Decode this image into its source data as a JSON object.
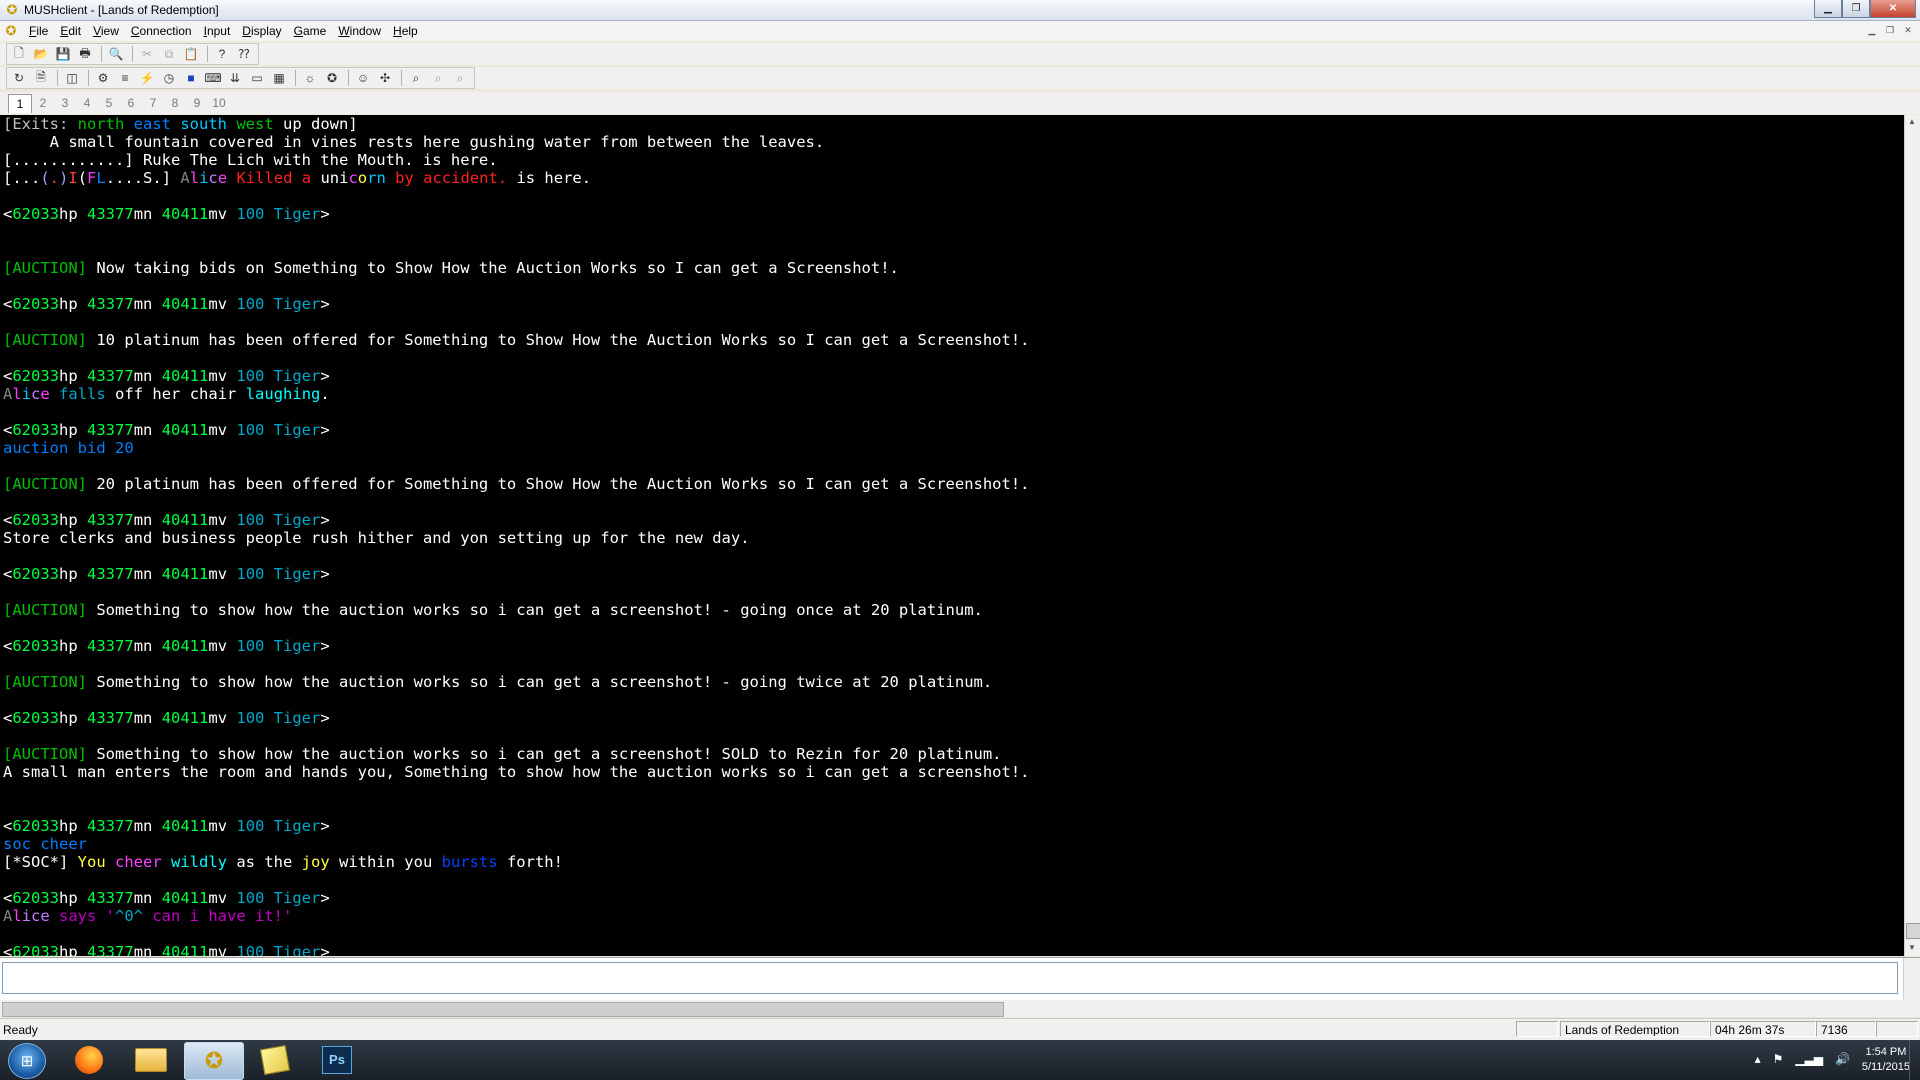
{
  "window": {
    "title": "MUSHclient - [Lands of Redemption]"
  },
  "menu": [
    {
      "pre": "",
      "ul": "F",
      "post": "ile"
    },
    {
      "pre": "",
      "ul": "E",
      "post": "dit"
    },
    {
      "pre": "",
      "ul": "V",
      "post": "iew"
    },
    {
      "pre": "",
      "ul": "C",
      "post": "onnection"
    },
    {
      "pre": "",
      "ul": "I",
      "post": "nput"
    },
    {
      "pre": "",
      "ul": "D",
      "post": "isplay"
    },
    {
      "pre": "",
      "ul": "G",
      "post": "ame"
    },
    {
      "pre": "",
      "ul": "W",
      "post": "indow"
    },
    {
      "pre": "",
      "ul": "H",
      "post": "elp"
    }
  ],
  "world_tabs": [
    "1",
    "2",
    "3",
    "4",
    "5",
    "6",
    "7",
    "8",
    "9",
    "10"
  ],
  "output_lines": [
    [
      {
        "t": "[Exits: ",
        "c": "#c0c0c0"
      },
      {
        "t": "north ",
        "c": "#00c000"
      },
      {
        "t": "east ",
        "c": "#0080ff"
      },
      {
        "t": "south ",
        "c": "#00c8ff"
      },
      {
        "t": "west ",
        "c": "#00c000"
      },
      {
        "t": "up down]",
        "c": "#ffffff"
      }
    ],
    [
      {
        "t": "     A small fountain covered in vines rests here gushing water from between the leaves.",
        "c": "#ffffff"
      }
    ],
    [
      {
        "t": "[............] Ruke The Lich with the Mouth. is here.",
        "c": "#ffffff"
      }
    ],
    [
      {
        "t": "[...",
        "c": "#ffffff"
      },
      {
        "t": "(",
        "c": "#a0a0ff"
      },
      {
        "t": ".",
        "c": "#ff4040"
      },
      {
        "t": ")",
        "c": "#a0a0ff"
      },
      {
        "t": "I",
        "c": "#ff4040"
      },
      {
        "t": "(",
        "c": "#ffffff"
      },
      {
        "t": "F",
        "c": "#ff40ff"
      },
      {
        "t": "L",
        "c": "#0080ff"
      },
      {
        "t": "....S.] ",
        "c": "#ffffff"
      },
      {
        "t": "A",
        "c": "#808080"
      },
      {
        "t": "l",
        "c": "#ff40ff"
      },
      {
        "t": "i",
        "c": "#00c8ff"
      },
      {
        "t": "c",
        "c": "#c080ff"
      },
      {
        "t": "e ",
        "c": "#ff40ff"
      },
      {
        "t": "Killed a ",
        "c": "#ff2020"
      },
      {
        "t": "uni",
        "c": "#ffffff"
      },
      {
        "t": "c",
        "c": "#ff40ff"
      },
      {
        "t": "o",
        "c": "#ffff40"
      },
      {
        "t": "rn ",
        "c": "#00c8ff"
      },
      {
        "t": "by accident.",
        "c": "#ff2020"
      },
      {
        "t": " is here.",
        "c": "#ffffff"
      }
    ],
    [],
    [
      {
        "t": "<",
        "c": "#ffffff"
      },
      {
        "t": "62033",
        "c": "#00ff40"
      },
      {
        "t": "hp ",
        "c": "#ffffff"
      },
      {
        "t": "43377",
        "c": "#00ff40"
      },
      {
        "t": "mn ",
        "c": "#ffffff"
      },
      {
        "t": "40411",
        "c": "#00ff40"
      },
      {
        "t": "mv ",
        "c": "#ffffff"
      },
      {
        "t": "100 Tiger",
        "c": "#00a8c8"
      },
      {
        "t": ">",
        "c": "#ffffff"
      }
    ],
    [],
    [],
    [
      {
        "t": "[AUCTION]",
        "c": "#00c000"
      },
      {
        "t": " Now taking bids on Something to Show How the Auction Works so I can get a Screenshot!.",
        "c": "#ffffff"
      }
    ],
    [],
    [
      {
        "t": "<",
        "c": "#ffffff"
      },
      {
        "t": "62033",
        "c": "#00ff40"
      },
      {
        "t": "hp ",
        "c": "#ffffff"
      },
      {
        "t": "43377",
        "c": "#00ff40"
      },
      {
        "t": "mn ",
        "c": "#ffffff"
      },
      {
        "t": "40411",
        "c": "#00ff40"
      },
      {
        "t": "mv ",
        "c": "#ffffff"
      },
      {
        "t": "100 Tiger",
        "c": "#00a8c8"
      },
      {
        "t": ">",
        "c": "#ffffff"
      }
    ],
    [],
    [
      {
        "t": "[AUCTION]",
        "c": "#00c000"
      },
      {
        "t": " 10 platinum has been offered for Something to Show How the Auction Works so I can get a Screenshot!.",
        "c": "#ffffff"
      }
    ],
    [],
    [
      {
        "t": "<",
        "c": "#ffffff"
      },
      {
        "t": "62033",
        "c": "#00ff40"
      },
      {
        "t": "hp ",
        "c": "#ffffff"
      },
      {
        "t": "43377",
        "c": "#00ff40"
      },
      {
        "t": "mn ",
        "c": "#ffffff"
      },
      {
        "t": "40411",
        "c": "#00ff40"
      },
      {
        "t": "mv ",
        "c": "#ffffff"
      },
      {
        "t": "100 Tiger",
        "c": "#00a8c8"
      },
      {
        "t": ">",
        "c": "#ffffff"
      }
    ],
    [
      {
        "t": "A",
        "c": "#808080"
      },
      {
        "t": "l",
        "c": "#ff40ff"
      },
      {
        "t": "i",
        "c": "#00c8ff"
      },
      {
        "t": "c",
        "c": "#c080ff"
      },
      {
        "t": "e ",
        "c": "#ff40ff"
      },
      {
        "t": "falls ",
        "c": "#00a8c8"
      },
      {
        "t": "off her chair ",
        "c": "#ffffff"
      },
      {
        "t": "laughing",
        "c": "#00ffff"
      },
      {
        "t": ".",
        "c": "#ffffff"
      }
    ],
    [],
    [
      {
        "t": "<",
        "c": "#ffffff"
      },
      {
        "t": "62033",
        "c": "#00ff40"
      },
      {
        "t": "hp ",
        "c": "#ffffff"
      },
      {
        "t": "43377",
        "c": "#00ff40"
      },
      {
        "t": "mn ",
        "c": "#ffffff"
      },
      {
        "t": "40411",
        "c": "#00ff40"
      },
      {
        "t": "mv ",
        "c": "#ffffff"
      },
      {
        "t": "100 Tiger",
        "c": "#00a8c8"
      },
      {
        "t": ">",
        "c": "#ffffff"
      }
    ],
    [
      {
        "t": "auction bid 20",
        "c": "#0080ff"
      }
    ],
    [],
    [
      {
        "t": "[AUCTION]",
        "c": "#00c000"
      },
      {
        "t": " 20 platinum has been offered for Something to Show How the Auction Works so I can get a Screenshot!.",
        "c": "#ffffff"
      }
    ],
    [],
    [
      {
        "t": "<",
        "c": "#ffffff"
      },
      {
        "t": "62033",
        "c": "#00ff40"
      },
      {
        "t": "hp ",
        "c": "#ffffff"
      },
      {
        "t": "43377",
        "c": "#00ff40"
      },
      {
        "t": "mn ",
        "c": "#ffffff"
      },
      {
        "t": "40411",
        "c": "#00ff40"
      },
      {
        "t": "mv ",
        "c": "#ffffff"
      },
      {
        "t": "100 Tiger",
        "c": "#00a8c8"
      },
      {
        "t": ">",
        "c": "#ffffff"
      }
    ],
    [
      {
        "t": "Store clerks and business people rush hither and yon setting up for the new day.",
        "c": "#ffffff"
      }
    ],
    [],
    [
      {
        "t": "<",
        "c": "#ffffff"
      },
      {
        "t": "62033",
        "c": "#00ff40"
      },
      {
        "t": "hp ",
        "c": "#ffffff"
      },
      {
        "t": "43377",
        "c": "#00ff40"
      },
      {
        "t": "mn ",
        "c": "#ffffff"
      },
      {
        "t": "40411",
        "c": "#00ff40"
      },
      {
        "t": "mv ",
        "c": "#ffffff"
      },
      {
        "t": "100 Tiger",
        "c": "#00a8c8"
      },
      {
        "t": ">",
        "c": "#ffffff"
      }
    ],
    [],
    [
      {
        "t": "[AUCTION]",
        "c": "#00c000"
      },
      {
        "t": " Something to show how the auction works so i can get a screenshot! - going once at 20 platinum.",
        "c": "#ffffff"
      }
    ],
    [],
    [
      {
        "t": "<",
        "c": "#ffffff"
      },
      {
        "t": "62033",
        "c": "#00ff40"
      },
      {
        "t": "hp ",
        "c": "#ffffff"
      },
      {
        "t": "43377",
        "c": "#00ff40"
      },
      {
        "t": "mn ",
        "c": "#ffffff"
      },
      {
        "t": "40411",
        "c": "#00ff40"
      },
      {
        "t": "mv ",
        "c": "#ffffff"
      },
      {
        "t": "100 Tiger",
        "c": "#00a8c8"
      },
      {
        "t": ">",
        "c": "#ffffff"
      }
    ],
    [],
    [
      {
        "t": "[AUCTION]",
        "c": "#00c000"
      },
      {
        "t": " Something to show how the auction works so i can get a screenshot! - going twice at 20 platinum.",
        "c": "#ffffff"
      }
    ],
    [],
    [
      {
        "t": "<",
        "c": "#ffffff"
      },
      {
        "t": "62033",
        "c": "#00ff40"
      },
      {
        "t": "hp ",
        "c": "#ffffff"
      },
      {
        "t": "43377",
        "c": "#00ff40"
      },
      {
        "t": "mn ",
        "c": "#ffffff"
      },
      {
        "t": "40411",
        "c": "#00ff40"
      },
      {
        "t": "mv ",
        "c": "#ffffff"
      },
      {
        "t": "100 Tiger",
        "c": "#00a8c8"
      },
      {
        "t": ">",
        "c": "#ffffff"
      }
    ],
    [],
    [
      {
        "t": "[AUCTION]",
        "c": "#00c000"
      },
      {
        "t": " Something to show how the auction works so i can get a screenshot! SOLD to Rezin for 20 platinum.",
        "c": "#ffffff"
      }
    ],
    [
      {
        "t": "A small man enters the room and hands you, Something to show how the auction works so i can get a screenshot!.",
        "c": "#ffffff"
      }
    ],
    [],
    [],
    [
      {
        "t": "<",
        "c": "#ffffff"
      },
      {
        "t": "62033",
        "c": "#00ff40"
      },
      {
        "t": "hp ",
        "c": "#ffffff"
      },
      {
        "t": "43377",
        "c": "#00ff40"
      },
      {
        "t": "mn ",
        "c": "#ffffff"
      },
      {
        "t": "40411",
        "c": "#00ff40"
      },
      {
        "t": "mv ",
        "c": "#ffffff"
      },
      {
        "t": "100 Tiger",
        "c": "#00a8c8"
      },
      {
        "t": ">",
        "c": "#ffffff"
      }
    ],
    [
      {
        "t": "soc cheer",
        "c": "#0080ff"
      }
    ],
    [
      {
        "t": "[*SOC*]",
        "c": "#ffffff"
      },
      {
        "t": " You ",
        "c": "#ffff40"
      },
      {
        "t": "cheer ",
        "c": "#ff40ff"
      },
      {
        "t": "wildly ",
        "c": "#00ffff"
      },
      {
        "t": "as the ",
        "c": "#ffffff"
      },
      {
        "t": "joy ",
        "c": "#ffff40"
      },
      {
        "t": "within you ",
        "c": "#ffffff"
      },
      {
        "t": "bursts ",
        "c": "#0040ff"
      },
      {
        "t": "forth!",
        "c": "#ffffff"
      }
    ],
    [],
    [
      {
        "t": "<",
        "c": "#ffffff"
      },
      {
        "t": "62033",
        "c": "#00ff40"
      },
      {
        "t": "hp ",
        "c": "#ffffff"
      },
      {
        "t": "43377",
        "c": "#00ff40"
      },
      {
        "t": "mn ",
        "c": "#ffffff"
      },
      {
        "t": "40411",
        "c": "#00ff40"
      },
      {
        "t": "mv ",
        "c": "#ffffff"
      },
      {
        "t": "100 Tiger",
        "c": "#00a8c8"
      },
      {
        "t": ">",
        "c": "#ffffff"
      }
    ],
    [
      {
        "t": "A",
        "c": "#808080"
      },
      {
        "t": "l",
        "c": "#ff40ff"
      },
      {
        "t": "ice ",
        "c": "#c080ff"
      },
      {
        "t": "says '",
        "c": "#c000c0"
      },
      {
        "t": "^0^ ",
        "c": "#00a8c8"
      },
      {
        "t": "can i have it!'",
        "c": "#c000c0"
      }
    ],
    [],
    [
      {
        "t": "<",
        "c": "#ffffff"
      },
      {
        "t": "62033",
        "c": "#00ff40"
      },
      {
        "t": "hp ",
        "c": "#ffffff"
      },
      {
        "t": "43377",
        "c": "#00ff40"
      },
      {
        "t": "mn ",
        "c": "#ffffff"
      },
      {
        "t": "40411",
        "c": "#00ff40"
      },
      {
        "t": "mv ",
        "c": "#ffffff"
      },
      {
        "t": "100 Tiger",
        "c": "#00a8c8"
      },
      {
        "t": ">",
        "c": "#ffffff"
      }
    ]
  ],
  "input": {
    "value": ""
  },
  "status": {
    "ready": "Ready",
    "world": "Lands of Redemption",
    "uptime": "04h 26m 37s",
    "lines": "7136"
  },
  "clock": {
    "time": "1:54 PM",
    "date": "5/11/2015"
  },
  "taskbar": {
    "photoshop_label": "Ps"
  },
  "icons": {
    "app": "mushclient-icon",
    "start": "windows-start-icon",
    "firefox": "firefox-icon",
    "explorer": "folder-icon",
    "notes": "sticky-notes-icon"
  }
}
